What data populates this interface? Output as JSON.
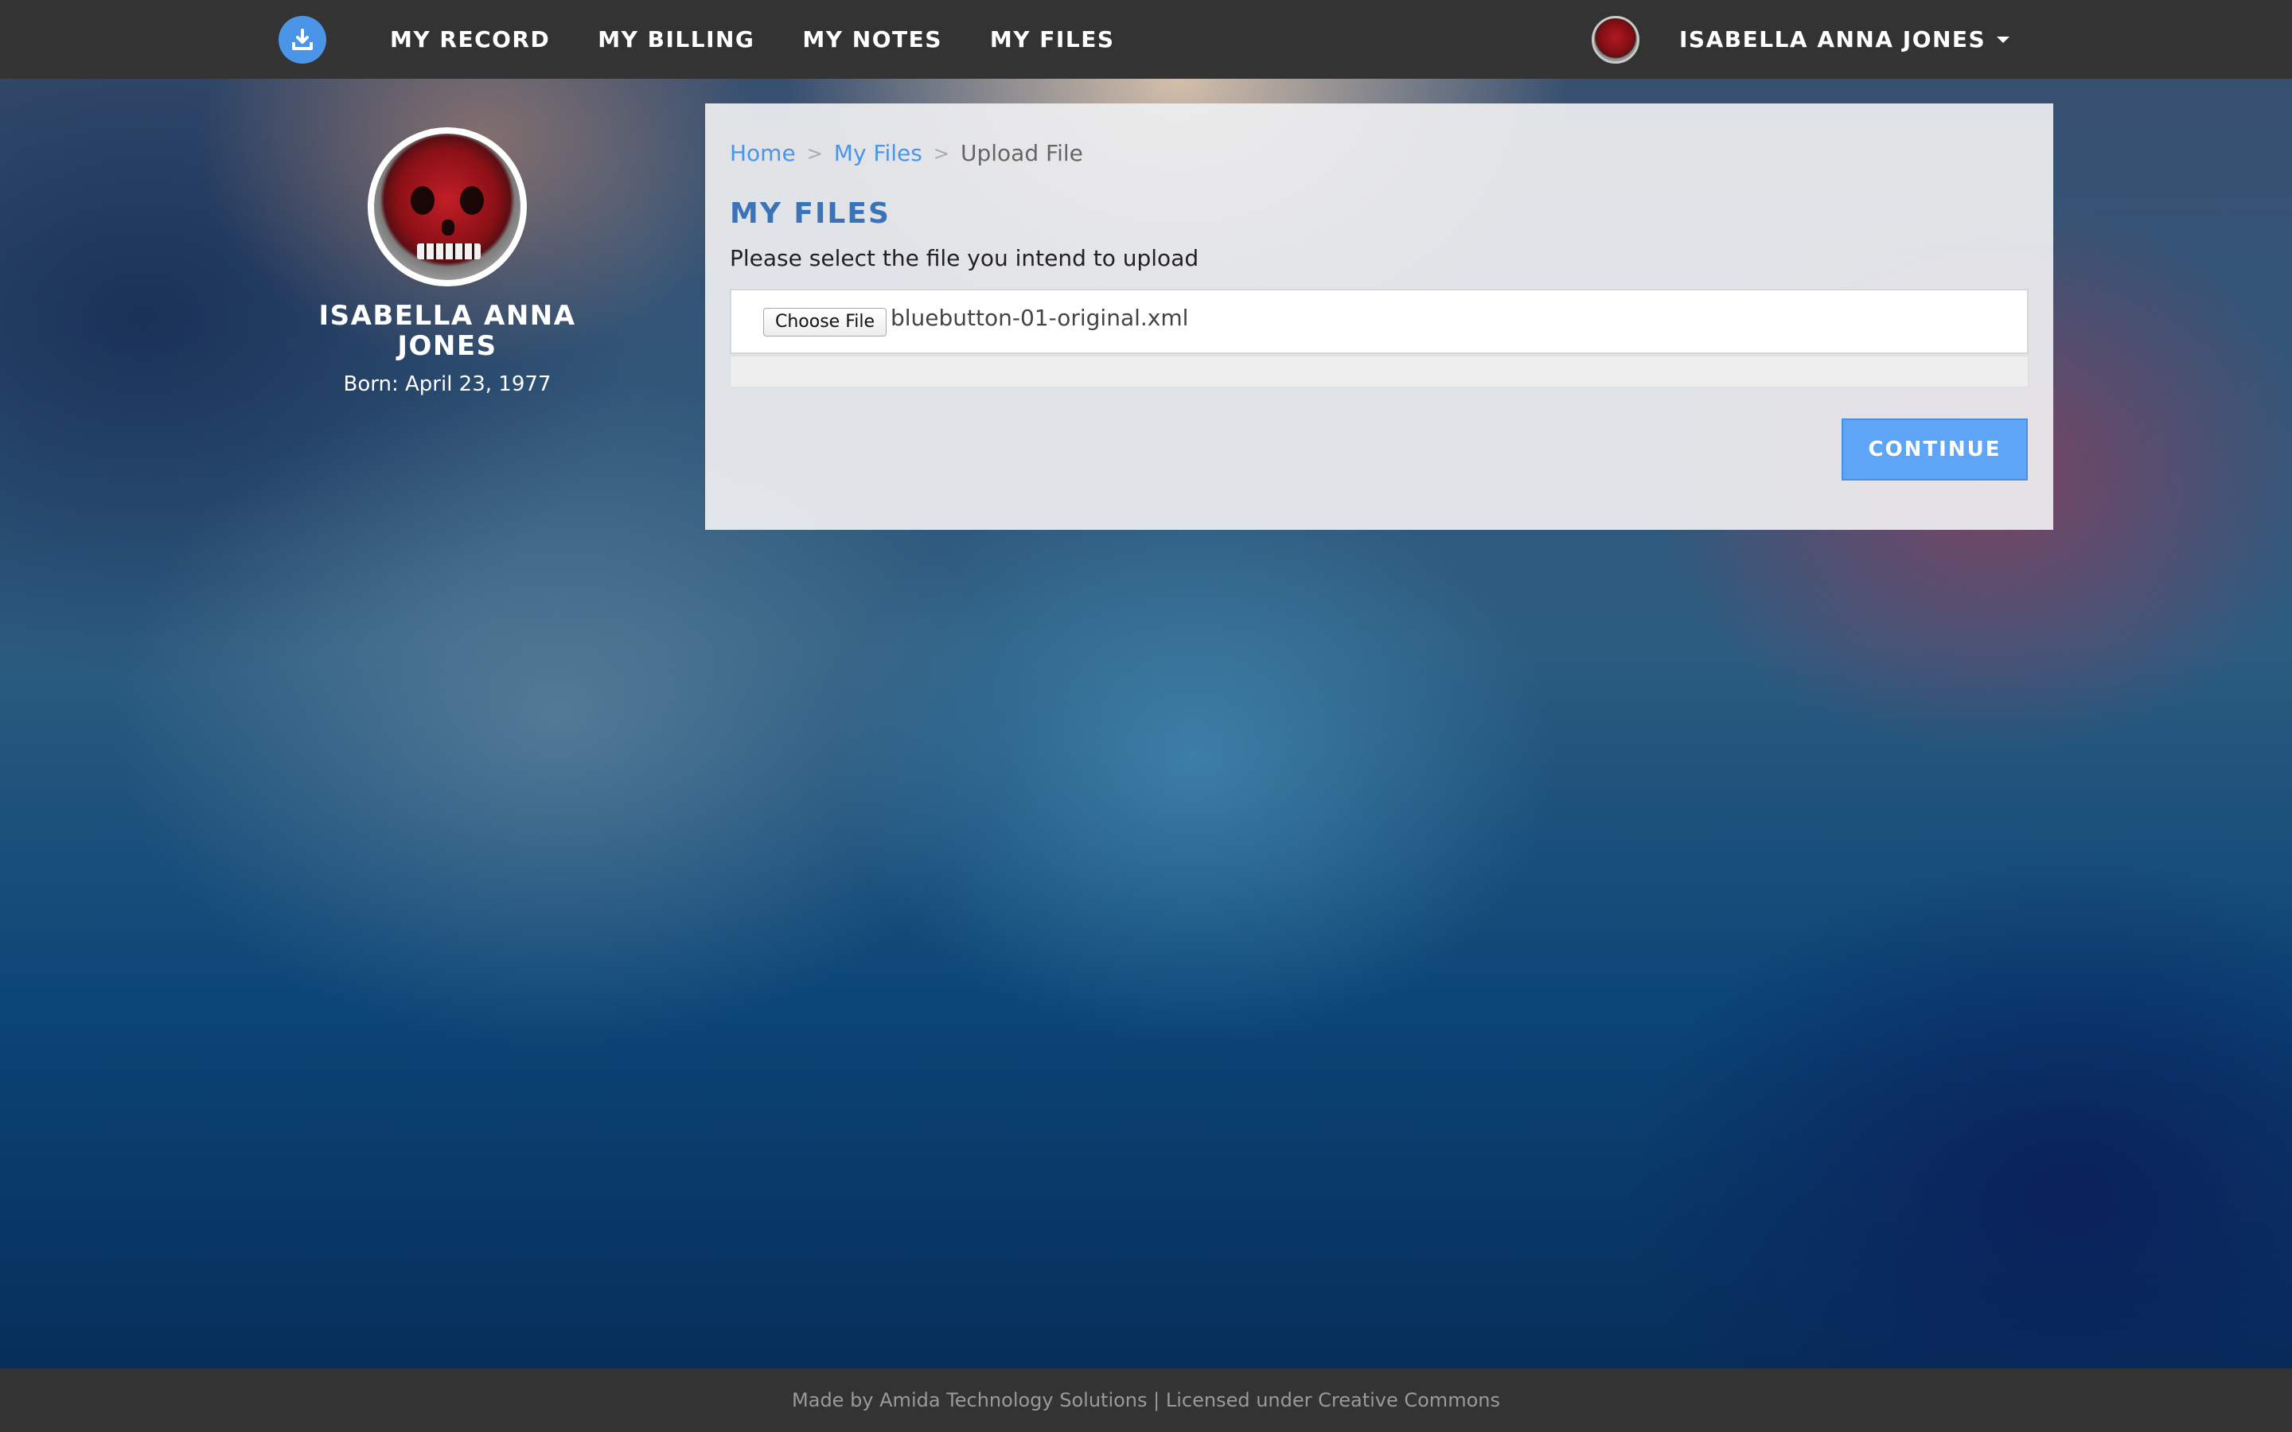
{
  "nav": {
    "brand_icon": "download-icon",
    "links": [
      {
        "label": "MY RECORD"
      },
      {
        "label": "MY BILLING"
      },
      {
        "label": "MY NOTES"
      },
      {
        "label": "MY FILES"
      }
    ],
    "user_name": "ISABELLA ANNA JONES"
  },
  "profile": {
    "name_line1": "ISABELLA ANNA",
    "name_line2": "JONES",
    "born": "Born: April 23, 1977"
  },
  "breadcrumb": {
    "home": "Home",
    "sep": ">",
    "files": "My Files",
    "current": "Upload File"
  },
  "main": {
    "title": "MY FILES",
    "instructions": "Please select the file you intend to upload",
    "choose_label": "Choose File",
    "file_name": "bluebutton-01-original.xml",
    "upload_progress": 0,
    "continue_label": "CONTINUE"
  },
  "footer": {
    "text": "Made by Amida Technology Solutions | Licensed under Creative Commons"
  },
  "colors": {
    "accent": "#4a95e8",
    "title_blue": "#3b73b9",
    "nav_bg": "#333333"
  }
}
